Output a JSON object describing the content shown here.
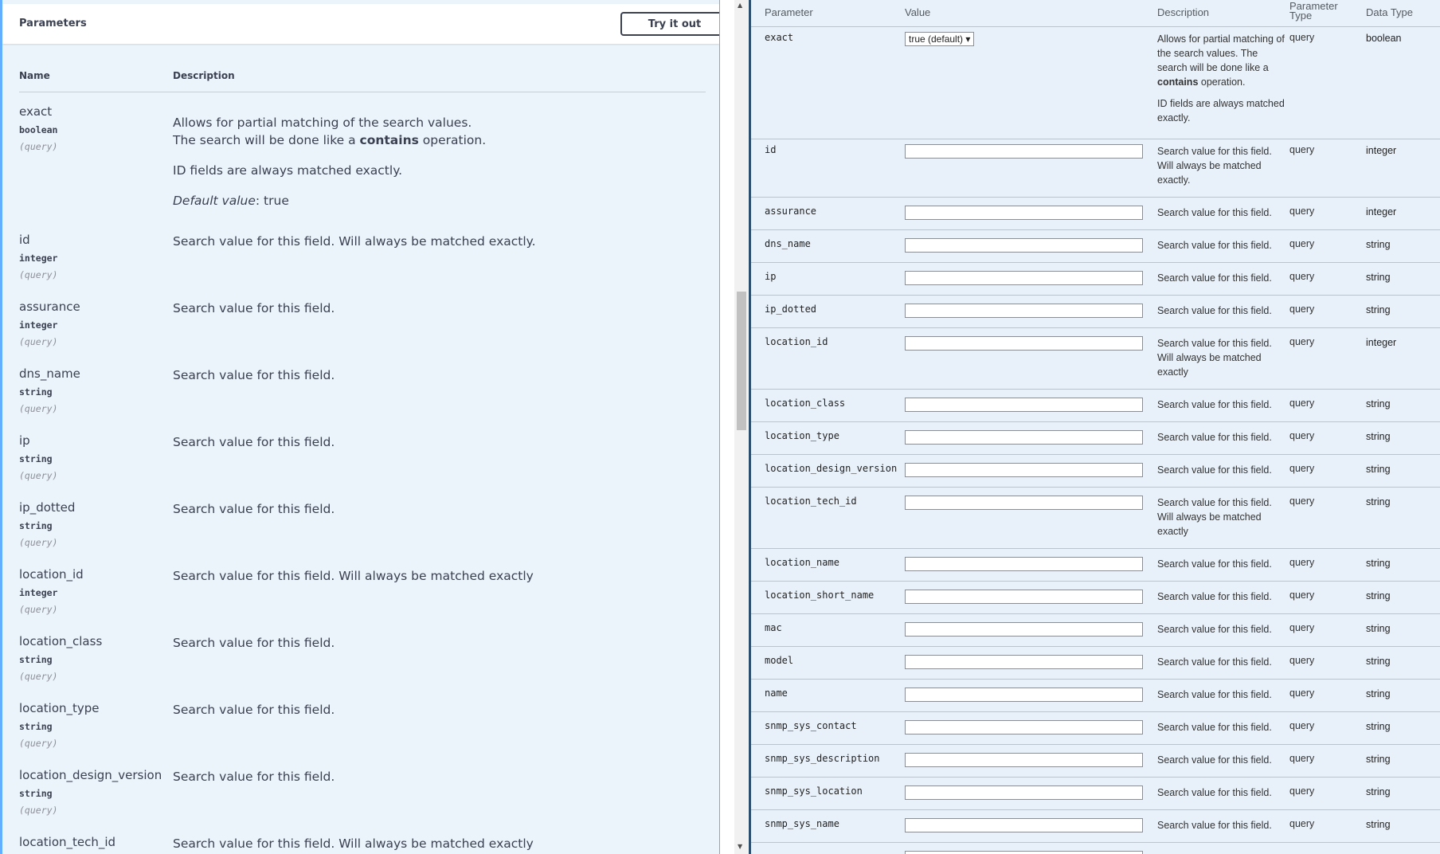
{
  "left": {
    "header_title": "Parameters",
    "try_button": "Try it out",
    "col_name": "Name",
    "col_description": "Description",
    "params": [
      {
        "name": "exact",
        "type": "boolean",
        "in": "(query)",
        "desc": [
          "Allows for partial matching of the search values.",
          "The search will be done like a ",
          "contains",
          " operation.",
          "ID fields are always matched exactly.",
          "Default value",
          ": true"
        ]
      },
      {
        "name": "id",
        "type": "integer",
        "in": "(query)",
        "desc": "Search value for this field. Will always be matched exactly."
      },
      {
        "name": "assurance",
        "type": "integer",
        "in": "(query)",
        "desc": "Search value for this field."
      },
      {
        "name": "dns_name",
        "type": "string",
        "in": "(query)",
        "desc": "Search value for this field."
      },
      {
        "name": "ip",
        "type": "string",
        "in": "(query)",
        "desc": "Search value for this field."
      },
      {
        "name": "ip_dotted",
        "type": "string",
        "in": "(query)",
        "desc": "Search value for this field."
      },
      {
        "name": "location_id",
        "type": "integer",
        "in": "(query)",
        "desc": "Search value for this field. Will always be matched exactly"
      },
      {
        "name": "location_class",
        "type": "string",
        "in": "(query)",
        "desc": "Search value for this field."
      },
      {
        "name": "location_type",
        "type": "string",
        "in": "(query)",
        "desc": "Search value for this field."
      },
      {
        "name": "location_design_version",
        "type": "string",
        "in": "(query)",
        "desc": "Search value for this field."
      },
      {
        "name": "location_tech_id",
        "type": "",
        "in": "",
        "desc": "Search value for this field. Will always be matched exactly"
      }
    ]
  },
  "right": {
    "headers": {
      "parameter": "Parameter",
      "value": "Value",
      "description": "Description",
      "param_type_1": "Parameter",
      "param_type_2": "Type",
      "data_type": "Data Type"
    },
    "exact_row": {
      "param": "exact",
      "select_value": "true (default) ▾",
      "desc_1": "Allows for partial matching of the search values. The search will be done like a ",
      "desc_bold": "contains",
      "desc_2": " operation.",
      "desc_3": "ID fields are always matched exactly.",
      "type": "query",
      "dtype": "boolean"
    },
    "rows": [
      {
        "param": "id",
        "desc": "Search value for this field. Will always be matched exactly.",
        "type": "query",
        "dtype": "integer"
      },
      {
        "param": "assurance",
        "desc": "Search value for this field.",
        "type": "query",
        "dtype": "integer"
      },
      {
        "param": "dns_name",
        "desc": "Search value for this field.",
        "type": "query",
        "dtype": "string"
      },
      {
        "param": "ip",
        "desc": "Search value for this field.",
        "type": "query",
        "dtype": "string"
      },
      {
        "param": "ip_dotted",
        "desc": "Search value for this field.",
        "type": "query",
        "dtype": "string"
      },
      {
        "param": "location_id",
        "desc": "Search value for this field. Will always be matched exactly",
        "type": "query",
        "dtype": "integer"
      },
      {
        "param": "location_class",
        "desc": "Search value for this field.",
        "type": "query",
        "dtype": "string"
      },
      {
        "param": "location_type",
        "desc": "Search value for this field.",
        "type": "query",
        "dtype": "string"
      },
      {
        "param": "location_design_version",
        "desc": "Search value for this field.",
        "type": "query",
        "dtype": "string"
      },
      {
        "param": "location_tech_id",
        "desc": "Search value for this field. Will always be matched exactly",
        "type": "query",
        "dtype": "string"
      },
      {
        "param": "location_name",
        "desc": "Search value for this field.",
        "type": "query",
        "dtype": "string"
      },
      {
        "param": "location_short_name",
        "desc": "Search value for this field.",
        "type": "query",
        "dtype": "string"
      },
      {
        "param": "mac",
        "desc": "Search value for this field.",
        "type": "query",
        "dtype": "string"
      },
      {
        "param": "model",
        "desc": "Search value for this field.",
        "type": "query",
        "dtype": "string"
      },
      {
        "param": "name",
        "desc": "Search value for this field.",
        "type": "query",
        "dtype": "string"
      },
      {
        "param": "snmp_sys_contact",
        "desc": "Search value for this field.",
        "type": "query",
        "dtype": "string"
      },
      {
        "param": "snmp_sys_description",
        "desc": "Search value for this field.",
        "type": "query",
        "dtype": "string"
      },
      {
        "param": "snmp_sys_location",
        "desc": "Search value for this field.",
        "type": "query",
        "dtype": "string"
      },
      {
        "param": "snmp_sys_name",
        "desc": "Search value for this field.",
        "type": "query",
        "dtype": "string"
      }
    ]
  },
  "scrollbar": {
    "up_icon": "scroll-up-arrow",
    "down_icon": "scroll-down-arrow"
  }
}
